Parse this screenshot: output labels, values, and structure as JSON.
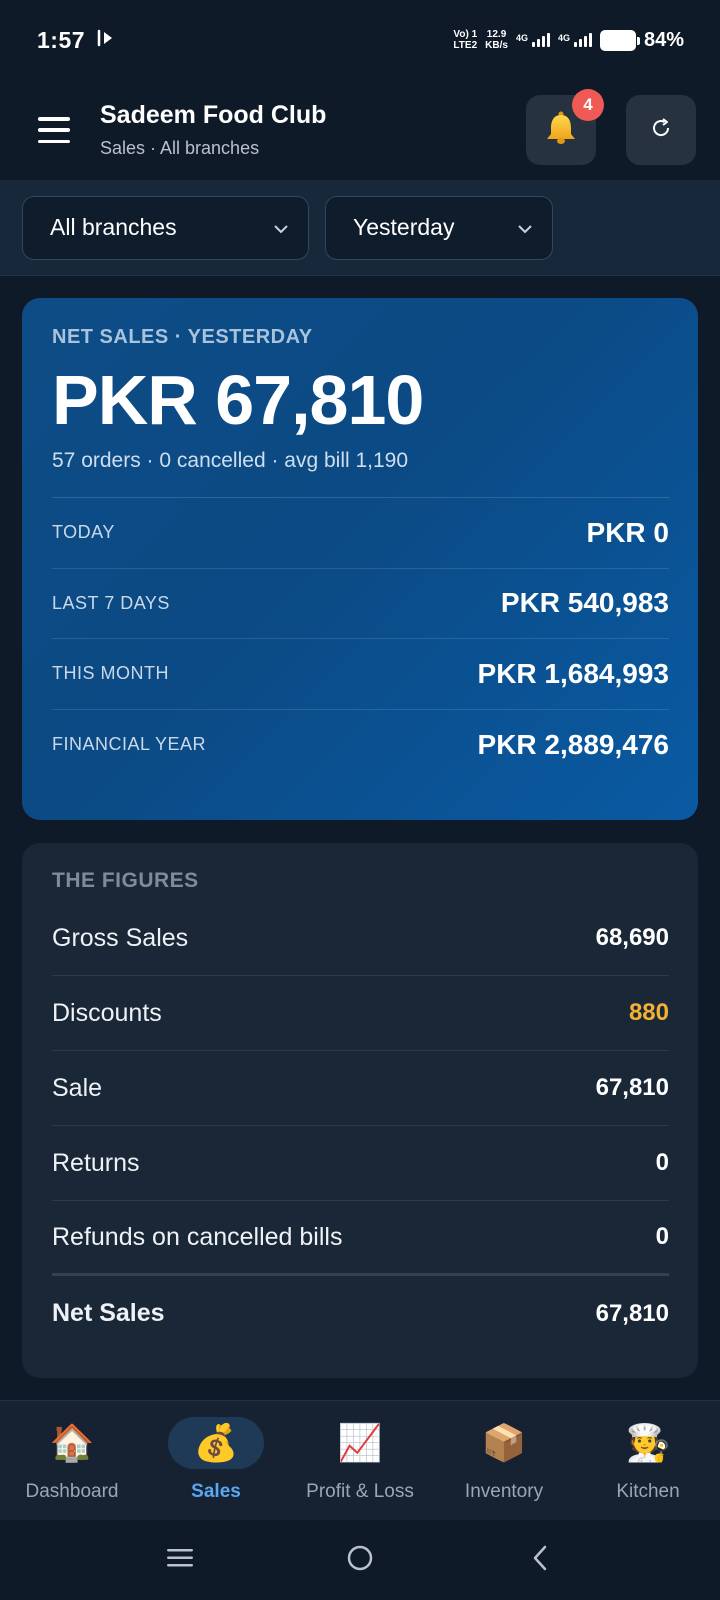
{
  "status_bar": {
    "time": "1:57",
    "network_line1": "Vo) 1",
    "network_line2": "LTE2",
    "speed_value": "12.9",
    "speed_unit": "KB/s",
    "sim1_type": "4G",
    "sim2_type": "4G",
    "battery_percent": "84%",
    "battery_level": 0.84
  },
  "header": {
    "title": "Sadeem Food Club",
    "subtitle": "Sales · All branches",
    "notification_count": "4"
  },
  "filters": {
    "branch": {
      "selected": "All branches"
    },
    "period": {
      "selected": "Yesterday"
    }
  },
  "net_sales": {
    "label": "NET SALES · YESTERDAY",
    "amount": "PKR 67,810",
    "meta": "57 orders · 0 cancelled · avg bill 1,190",
    "periods": [
      {
        "label": "TODAY",
        "value": "PKR 0"
      },
      {
        "label": "LAST 7 DAYS",
        "value": "PKR 540,983"
      },
      {
        "label": "THIS MONTH",
        "value": "PKR 1,684,993"
      },
      {
        "label": "FINANCIAL YEAR",
        "value": "PKR 2,889,476"
      }
    ]
  },
  "figures": {
    "title": "THE FIGURES",
    "rows": [
      {
        "label": "Gross Sales",
        "value": "68,690",
        "color": "#ffffff"
      },
      {
        "label": "Discounts",
        "value": "880",
        "color": "#f2b133"
      },
      {
        "label": "Sale",
        "value": "67,810",
        "color": "#ffffff"
      },
      {
        "label": "Returns",
        "value": "0",
        "color": "#ffffff"
      },
      {
        "label": "Refunds on cancelled bills",
        "value": "0",
        "color": "#ffffff"
      },
      {
        "label": "Net Sales",
        "value": "67,810",
        "color": "#ffffff"
      }
    ]
  },
  "bottom_nav": {
    "items": [
      {
        "label": "Dashboard",
        "icon": "🏠",
        "icon_name": "house-icon",
        "active": false
      },
      {
        "label": "Sales",
        "icon": "💰",
        "icon_name": "money-bag-icon",
        "active": true
      },
      {
        "label": "Profit & Loss",
        "icon": "📈",
        "icon_name": "chart-increasing-icon",
        "active": false
      },
      {
        "label": "Inventory",
        "icon": "📦",
        "icon_name": "package-icon",
        "active": false
      },
      {
        "label": "Kitchen",
        "icon": "🧑‍🍳",
        "icon_name": "cook-icon",
        "active": false
      }
    ]
  },
  "colors": {
    "accent": "#5aa8f0",
    "badge": "#f05a55",
    "discount": "#f2b133",
    "card_blue": "#0b4a84"
  }
}
